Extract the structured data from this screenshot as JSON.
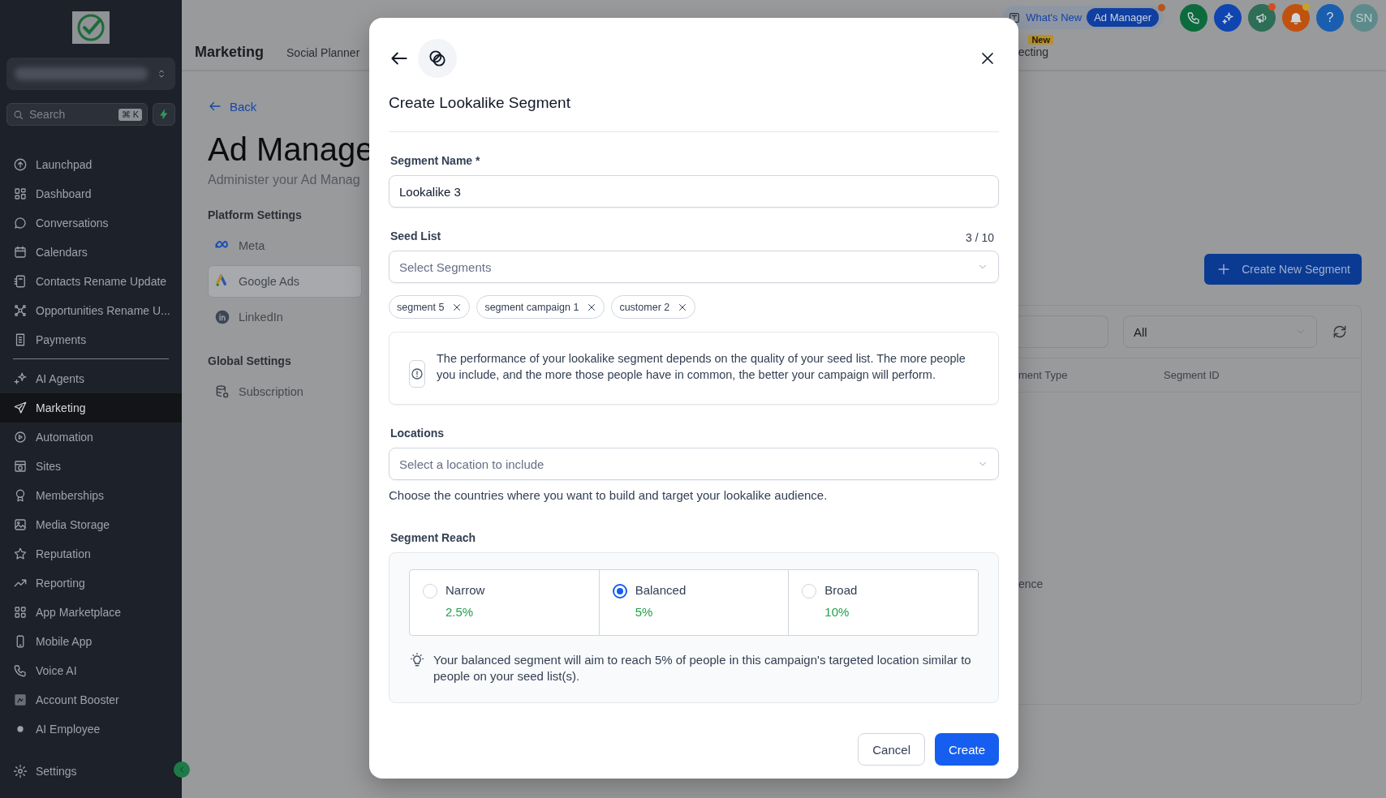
{
  "sidebar": {
    "search": {
      "placeholder": "Search",
      "shortcut": "⌘ K"
    },
    "groups": [
      {
        "items": [
          {
            "label": "Launchpad",
            "selected": false
          },
          {
            "label": "Dashboard",
            "selected": false
          },
          {
            "label": "Conversations",
            "selected": false
          },
          {
            "label": "Calendars",
            "selected": false
          },
          {
            "label": "Contacts Rename Update",
            "selected": false
          },
          {
            "label": "Opportunities Rename U...",
            "selected": false
          },
          {
            "label": "Payments",
            "selected": false
          }
        ]
      },
      {
        "items": [
          {
            "label": "AI Agents",
            "selected": false
          },
          {
            "label": "Marketing",
            "selected": true
          },
          {
            "label": "Automation",
            "selected": false
          },
          {
            "label": "Sites",
            "selected": false
          },
          {
            "label": "Memberships",
            "selected": false
          },
          {
            "label": "Media Storage",
            "selected": false
          },
          {
            "label": "Reputation",
            "selected": false
          },
          {
            "label": "Reporting",
            "selected": false
          },
          {
            "label": "App Marketplace",
            "selected": false
          },
          {
            "label": "Mobile App",
            "selected": false
          },
          {
            "label": "Voice AI",
            "selected": false
          },
          {
            "label": "Account Booster",
            "selected": false
          },
          {
            "label": "AI Employee",
            "selected": false
          }
        ]
      }
    ],
    "footer": {
      "label": "Settings"
    }
  },
  "topbar": {
    "title": "Marketing",
    "tabs": [
      {
        "label": "Social Planner"
      },
      {
        "label": "ecting",
        "badge": "New"
      }
    ],
    "whats_new": {
      "label": "What's New",
      "current": "Ad Manager",
      "notification": true
    },
    "actions": [
      {
        "notification": false
      },
      {
        "notification": false
      },
      {
        "notification": true
      },
      {
        "notification": true
      },
      {
        "label": "?",
        "notification": false
      }
    ],
    "avatar": "SN"
  },
  "page": {
    "back": "Back",
    "title": "Ad Manage",
    "subtitle": "Administer your Ad Manag",
    "sections": [
      {
        "title": "Platform Settings",
        "items": [
          {
            "label": "Meta",
            "selected": false
          },
          {
            "label": "Google Ads",
            "selected": true
          },
          {
            "label": "LinkedIn",
            "selected": false
          }
        ]
      },
      {
        "title": "Global Settings",
        "items": [
          {
            "label": "Subscription",
            "selected": false
          }
        ]
      }
    ]
  },
  "segments": {
    "create_button": "Create New Segment",
    "filter": {
      "value": "All"
    },
    "columns": [
      "ment Type",
      "Segment ID"
    ],
    "rows": [
      {
        "cells": [
          "ence"
        ]
      }
    ]
  },
  "modal": {
    "title": "Create Lookalike Segment",
    "segment_name": {
      "label": "Segment Name *",
      "value": "Lookalike 3"
    },
    "seed_list": {
      "label": "Seed List",
      "count": "3 / 10",
      "placeholder": "Select Segments",
      "chips": [
        "segment 5",
        "segment campaign 1",
        "customer 2"
      ]
    },
    "info": "The performance of your lookalike segment depends on the quality of your seed list. The more people you include, and the more those people have in common, the better your campaign will perform.",
    "locations": {
      "label": "Locations",
      "placeholder": "Select a location to include",
      "help": "Choose the countries where you want to build and target your lookalike audience."
    },
    "reach": {
      "label": "Segment Reach",
      "options": [
        {
          "label": "Narrow",
          "value": "2.5%",
          "selected": false
        },
        {
          "label": "Balanced",
          "value": "5%",
          "selected": true
        },
        {
          "label": "Broad",
          "value": "10%",
          "selected": false
        }
      ],
      "hint": "Your balanced segment will aim to reach 5% of people in this campaign's targeted location similar to people on your seed list(s)."
    },
    "buttons": [
      {
        "label": "Cancel",
        "kind": "secondary"
      },
      {
        "label": "Create",
        "kind": "primary"
      }
    ]
  }
}
